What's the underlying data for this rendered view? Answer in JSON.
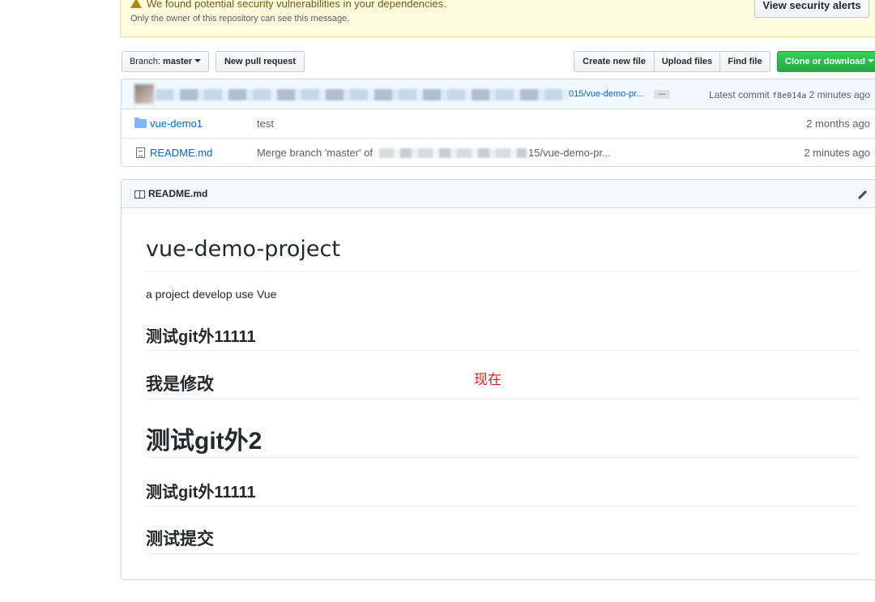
{
  "alert": {
    "title": "We found potential security vulnerabilities in your dependencies.",
    "subtitle": "Only the owner of this repository can see this message.",
    "button": "View security alerts"
  },
  "toolbar": {
    "branch_prefix": "Branch:",
    "branch_name": "master",
    "new_pull_request": "New pull request",
    "create_new_file": "Create new file",
    "upload_files": "Upload files",
    "find_file": "Find file",
    "clone_or_download": "Clone or download"
  },
  "commit": {
    "link_text": "015/vue-demo-pr...",
    "ellipsis": "…",
    "latest_label": "Latest commit",
    "sha": "f8e014a",
    "age": "2 minutes ago"
  },
  "files": [
    {
      "type": "folder",
      "name": "vue-demo1",
      "message": "test",
      "age": "2 months ago"
    },
    {
      "type": "file",
      "name": "README.md",
      "message_prefix": "Merge branch 'master' of",
      "message_suffix": "15/vue-demo-pr...",
      "age": "2 minutes ago"
    }
  ],
  "readme": {
    "header": "README.md",
    "h1": "vue-demo-project",
    "paragraph": "a project develop use Vue",
    "heading_1": "测试git外11111",
    "heading_2": "我是修改",
    "heading_3": "测试git外2",
    "heading_4": "测试git外11111",
    "heading_5": "测试提交"
  },
  "annotation": "现在",
  "colors": {
    "accent_link": "#0366d6",
    "clone_green": "#28a745",
    "annotation_red": "#e02020",
    "alert_bg": "#fffbdd"
  }
}
